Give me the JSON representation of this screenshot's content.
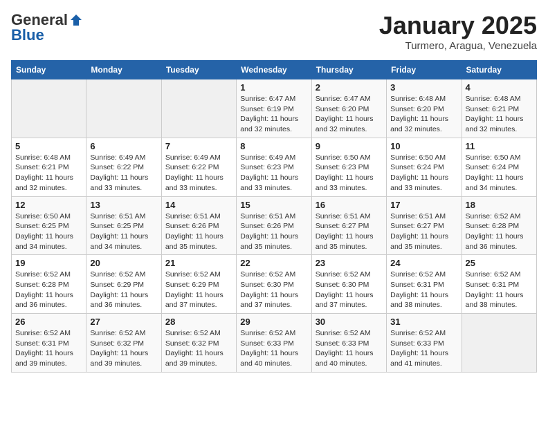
{
  "logo": {
    "general": "General",
    "blue": "Blue"
  },
  "header": {
    "month": "January 2025",
    "location": "Turmero, Aragua, Venezuela"
  },
  "weekdays": [
    "Sunday",
    "Monday",
    "Tuesday",
    "Wednesday",
    "Thursday",
    "Friday",
    "Saturday"
  ],
  "weeks": [
    [
      {
        "day": "",
        "info": ""
      },
      {
        "day": "",
        "info": ""
      },
      {
        "day": "",
        "info": ""
      },
      {
        "day": "1",
        "info": "Sunrise: 6:47 AM\nSunset: 6:19 PM\nDaylight: 11 hours and 32 minutes."
      },
      {
        "day": "2",
        "info": "Sunrise: 6:47 AM\nSunset: 6:20 PM\nDaylight: 11 hours and 32 minutes."
      },
      {
        "day": "3",
        "info": "Sunrise: 6:48 AM\nSunset: 6:20 PM\nDaylight: 11 hours and 32 minutes."
      },
      {
        "day": "4",
        "info": "Sunrise: 6:48 AM\nSunset: 6:21 PM\nDaylight: 11 hours and 32 minutes."
      }
    ],
    [
      {
        "day": "5",
        "info": "Sunrise: 6:48 AM\nSunset: 6:21 PM\nDaylight: 11 hours and 32 minutes."
      },
      {
        "day": "6",
        "info": "Sunrise: 6:49 AM\nSunset: 6:22 PM\nDaylight: 11 hours and 33 minutes."
      },
      {
        "day": "7",
        "info": "Sunrise: 6:49 AM\nSunset: 6:22 PM\nDaylight: 11 hours and 33 minutes."
      },
      {
        "day": "8",
        "info": "Sunrise: 6:49 AM\nSunset: 6:23 PM\nDaylight: 11 hours and 33 minutes."
      },
      {
        "day": "9",
        "info": "Sunrise: 6:50 AM\nSunset: 6:23 PM\nDaylight: 11 hours and 33 minutes."
      },
      {
        "day": "10",
        "info": "Sunrise: 6:50 AM\nSunset: 6:24 PM\nDaylight: 11 hours and 33 minutes."
      },
      {
        "day": "11",
        "info": "Sunrise: 6:50 AM\nSunset: 6:24 PM\nDaylight: 11 hours and 34 minutes."
      }
    ],
    [
      {
        "day": "12",
        "info": "Sunrise: 6:50 AM\nSunset: 6:25 PM\nDaylight: 11 hours and 34 minutes."
      },
      {
        "day": "13",
        "info": "Sunrise: 6:51 AM\nSunset: 6:25 PM\nDaylight: 11 hours and 34 minutes."
      },
      {
        "day": "14",
        "info": "Sunrise: 6:51 AM\nSunset: 6:26 PM\nDaylight: 11 hours and 35 minutes."
      },
      {
        "day": "15",
        "info": "Sunrise: 6:51 AM\nSunset: 6:26 PM\nDaylight: 11 hours and 35 minutes."
      },
      {
        "day": "16",
        "info": "Sunrise: 6:51 AM\nSunset: 6:27 PM\nDaylight: 11 hours and 35 minutes."
      },
      {
        "day": "17",
        "info": "Sunrise: 6:51 AM\nSunset: 6:27 PM\nDaylight: 11 hours and 35 minutes."
      },
      {
        "day": "18",
        "info": "Sunrise: 6:52 AM\nSunset: 6:28 PM\nDaylight: 11 hours and 36 minutes."
      }
    ],
    [
      {
        "day": "19",
        "info": "Sunrise: 6:52 AM\nSunset: 6:28 PM\nDaylight: 11 hours and 36 minutes."
      },
      {
        "day": "20",
        "info": "Sunrise: 6:52 AM\nSunset: 6:29 PM\nDaylight: 11 hours and 36 minutes."
      },
      {
        "day": "21",
        "info": "Sunrise: 6:52 AM\nSunset: 6:29 PM\nDaylight: 11 hours and 37 minutes."
      },
      {
        "day": "22",
        "info": "Sunrise: 6:52 AM\nSunset: 6:30 PM\nDaylight: 11 hours and 37 minutes."
      },
      {
        "day": "23",
        "info": "Sunrise: 6:52 AM\nSunset: 6:30 PM\nDaylight: 11 hours and 37 minutes."
      },
      {
        "day": "24",
        "info": "Sunrise: 6:52 AM\nSunset: 6:31 PM\nDaylight: 11 hours and 38 minutes."
      },
      {
        "day": "25",
        "info": "Sunrise: 6:52 AM\nSunset: 6:31 PM\nDaylight: 11 hours and 38 minutes."
      }
    ],
    [
      {
        "day": "26",
        "info": "Sunrise: 6:52 AM\nSunset: 6:31 PM\nDaylight: 11 hours and 39 minutes."
      },
      {
        "day": "27",
        "info": "Sunrise: 6:52 AM\nSunset: 6:32 PM\nDaylight: 11 hours and 39 minutes."
      },
      {
        "day": "28",
        "info": "Sunrise: 6:52 AM\nSunset: 6:32 PM\nDaylight: 11 hours and 39 minutes."
      },
      {
        "day": "29",
        "info": "Sunrise: 6:52 AM\nSunset: 6:33 PM\nDaylight: 11 hours and 40 minutes."
      },
      {
        "day": "30",
        "info": "Sunrise: 6:52 AM\nSunset: 6:33 PM\nDaylight: 11 hours and 40 minutes."
      },
      {
        "day": "31",
        "info": "Sunrise: 6:52 AM\nSunset: 6:33 PM\nDaylight: 11 hours and 41 minutes."
      },
      {
        "day": "",
        "info": ""
      }
    ]
  ]
}
